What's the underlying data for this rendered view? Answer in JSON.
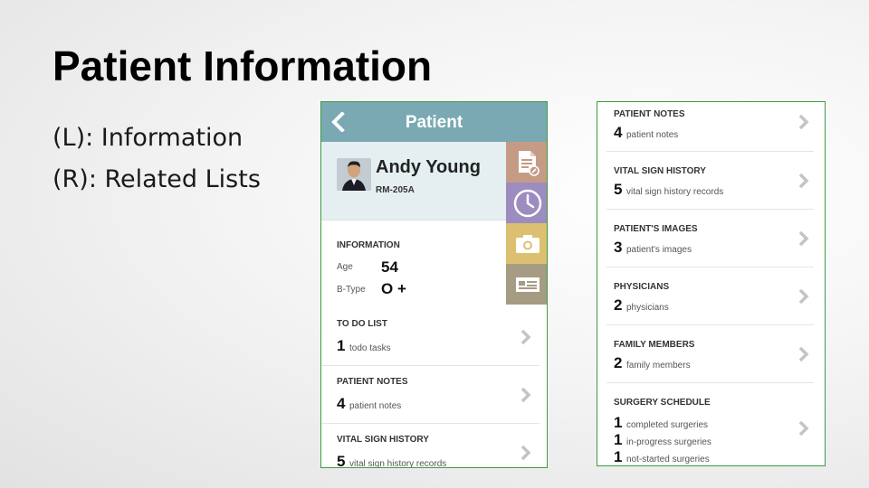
{
  "slide": {
    "title": "Patient Information",
    "bullets": [
      "(L): Information",
      "(R): Related Lists"
    ]
  },
  "phone": {
    "header_title": "Patient",
    "patient_name": "Andy Young",
    "room": "RM-205A",
    "info_heading": "INFORMATION",
    "age_label": "Age",
    "age_value": "54",
    "btype_label": "B-Type",
    "btype_value": "O +",
    "tiles": [
      {
        "icon": "document-icon",
        "color": "#c69b86"
      },
      {
        "icon": "clock-icon",
        "color": "#9d8cbf"
      },
      {
        "icon": "camera-icon",
        "color": "#dcc071"
      },
      {
        "icon": "id-card-icon",
        "color": "#a69b83"
      }
    ],
    "rows": [
      {
        "heading": "TO DO LIST",
        "count": "1",
        "desc": "todo tasks"
      },
      {
        "heading": "PATIENT NOTES",
        "count": "4",
        "desc": "patient notes"
      },
      {
        "heading": "VITAL SIGN HISTORY",
        "count": "5",
        "desc": "vital sign history records"
      }
    ]
  },
  "related": {
    "rows": [
      {
        "heading": "PATIENT NOTES",
        "count": "4",
        "desc": "patient notes"
      },
      {
        "heading": "VITAL SIGN HISTORY",
        "count": "5",
        "desc": "vital sign history records"
      },
      {
        "heading": "PATIENT'S IMAGES",
        "count": "3",
        "desc": "patient's images"
      },
      {
        "heading": "PHYSICIANS",
        "count": "2",
        "desc": "physicians"
      },
      {
        "heading": "FAMILY MEMBERS",
        "count": "2",
        "desc": "family members"
      }
    ],
    "surgery": {
      "heading": "SURGERY SCHEDULE",
      "lines": [
        {
          "count": "1",
          "desc": "completed surgeries"
        },
        {
          "count": "1",
          "desc": "in-progress surgeries"
        },
        {
          "count": "1",
          "desc": "not-started surgeries"
        }
      ]
    }
  },
  "colors": {
    "header": "#7aa9b4",
    "profile_bg": "#e5eff2",
    "panel_border": "#3f9b3f"
  }
}
